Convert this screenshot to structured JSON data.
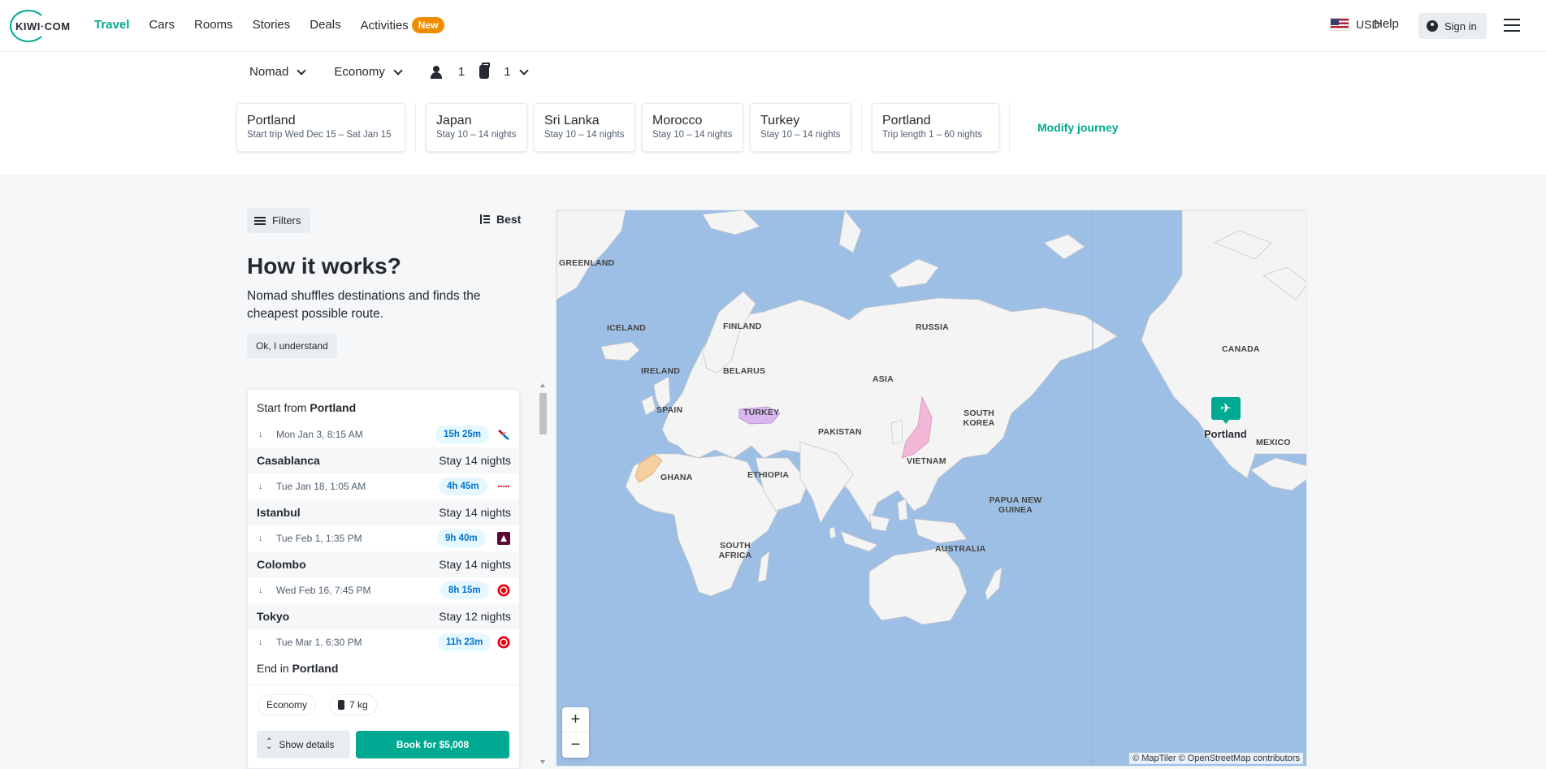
{
  "nav": {
    "logo": "KIWI·COM",
    "links": [
      "Travel",
      "Cars",
      "Rooms",
      "Stories",
      "Deals",
      "Activities"
    ],
    "new_badge": "New",
    "currency": "USD",
    "help": "Help",
    "signin": "Sign in"
  },
  "search": {
    "mode": "Nomad",
    "cabin": "Economy",
    "passengers": "1",
    "bags": "1",
    "stops": [
      {
        "city": "Portland",
        "sub": "Start trip Wed Dec 15 – Sat Jan 15"
      },
      {
        "city": "Japan",
        "sub": "Stay 10 – 14 nights"
      },
      {
        "city": "Sri Lanka",
        "sub": "Stay 10 – 14 nights"
      },
      {
        "city": "Morocco",
        "sub": "Stay 10 – 14 nights"
      },
      {
        "city": "Turkey",
        "sub": "Stay 10 – 14 nights"
      },
      {
        "city": "Portland",
        "sub": "Trip length 1 – 60 nights"
      }
    ],
    "modify": "Modify journey"
  },
  "panel": {
    "filters": "Filters",
    "sort": "Best",
    "how_title": "How it works?",
    "how_text": "Nomad shuffles destinations and finds the cheapest possible route.",
    "ok": "Ok, I understand"
  },
  "itinerary": {
    "start_prefix": "Start from",
    "start_city": "Portland",
    "end_prefix": "End in",
    "end_city": "Portland",
    "legs": [
      {
        "date": "Mon Jan 3, 8:15 AM",
        "duration": "15h 25m",
        "carrier": "american"
      },
      {
        "date": "Tue Jan 18, 1:05 AM",
        "duration": "4h 45m",
        "carrier": "red-dash"
      },
      {
        "date": "Tue Feb 1, 1:35 PM",
        "duration": "9h 40m",
        "carrier": "qatar"
      },
      {
        "date": "Wed Feb 16, 7:45 PM",
        "duration": "8h 15m",
        "carrier": "jal"
      },
      {
        "date": "Tue Mar 1, 6:30 PM",
        "duration": "11h 23m",
        "carrier": "jal"
      }
    ],
    "destinations": [
      {
        "name": "Casablanca",
        "stay": "Stay 14 nights"
      },
      {
        "name": "Istanbul",
        "stay": "Stay 14 nights"
      },
      {
        "name": "Colombo",
        "stay": "Stay 14 nights"
      },
      {
        "name": "Tokyo",
        "stay": "Stay 12 nights"
      }
    ],
    "cabin_tag": "Economy",
    "bag_tag": "7 kg",
    "show_details": "Show details",
    "book": "Book for $5,008"
  },
  "map": {
    "labels": [
      "GREENLAND",
      "ICELAND",
      "FINLAND",
      "RUSSIA",
      "CANADA",
      "IRELAND",
      "BELARUS",
      "ASIA",
      "SPAIN",
      "TURKEY",
      "SOUTH KOREA",
      "PAKISTAN",
      "MEXICO",
      "GHANA",
      "ETHIOPIA",
      "VIETNAM",
      "PAPUA NEW GUINEA",
      "SOUTH AFRICA",
      "AUSTRALIA"
    ],
    "pin_city": "Portland",
    "zoom_in": "+",
    "zoom_out": "−",
    "attribution": "© MapTiler © OpenStreetMap contributors",
    "highlight_colors": {
      "turkey": "#d9b8f0",
      "japan": "#f2b8d6",
      "morocco": "#f5cfa0"
    }
  },
  "colors": {
    "accent": "#00a991",
    "badge": "#f08c00",
    "water": "#9dbfe6",
    "land": "#f4f4f4"
  }
}
